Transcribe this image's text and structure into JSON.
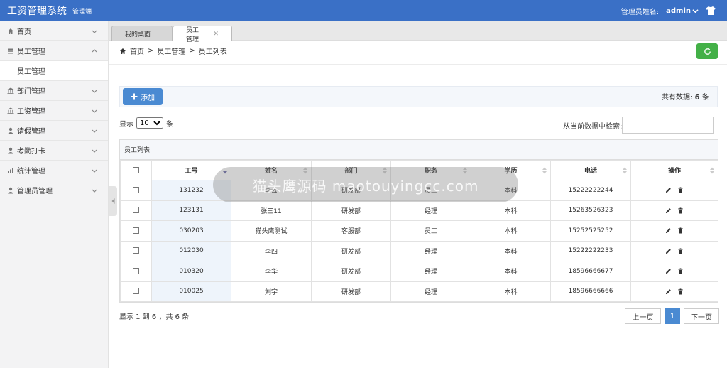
{
  "app": {
    "title": "工资管理系统",
    "subtitle": "管理端",
    "admin_label": "管理员姓名:",
    "admin_name": "admin"
  },
  "sidebar": {
    "items": [
      {
        "label": "首页",
        "icon": "home-icon"
      },
      {
        "label": "员工管理",
        "icon": "list-icon",
        "expanded": true,
        "sub": [
          "员工管理"
        ]
      },
      {
        "label": "部门管理",
        "icon": "bank-icon"
      },
      {
        "label": "工资管理",
        "icon": "bank-icon"
      },
      {
        "label": "请假管理",
        "icon": "user-icon"
      },
      {
        "label": "考勤打卡",
        "icon": "user-icon"
      },
      {
        "label": "统计管理",
        "icon": "chart-icon"
      },
      {
        "label": "管理员管理",
        "icon": "user-icon"
      }
    ]
  },
  "tabs": [
    {
      "label": "我的桌面"
    },
    {
      "label": "员工管理",
      "active": true
    }
  ],
  "breadcrumb": [
    "首页",
    "员工管理",
    "员工列表"
  ],
  "toolbar": {
    "add_label": "添加",
    "total_prefix": "共有数据:",
    "total_count": "6",
    "total_suffix": "条"
  },
  "length": {
    "prefix": "显示",
    "value": "10",
    "suffix": "条"
  },
  "search": {
    "label": "从当前数据中检索:",
    "value": ""
  },
  "table": {
    "title": "员工列表",
    "columns": [
      "工号",
      "姓名",
      "部门",
      "职务",
      "学历",
      "电话",
      "操作"
    ],
    "rows": [
      [
        "131232",
        "李云",
        "研发部",
        "员工",
        "本科",
        "15222222244"
      ],
      [
        "123131",
        "张三11",
        "研发部",
        "经理",
        "本科",
        "15263526323"
      ],
      [
        "030203",
        "猫头鹰测试",
        "客服部",
        "员工",
        "本科",
        "15252525252"
      ],
      [
        "012030",
        "李四",
        "研发部",
        "经理",
        "本科",
        "15222222233"
      ],
      [
        "010320",
        "李华",
        "研发部",
        "经理",
        "本科",
        "18596666677"
      ],
      [
        "010025",
        "刘宇",
        "研发部",
        "经理",
        "本科",
        "18596666666"
      ]
    ]
  },
  "footer": {
    "info": "显示 1 到 6 ，共 6 条",
    "prev": "上一页",
    "page": "1",
    "next": "下一页"
  },
  "watermark": {
    "text": "猫头鹰源码 maotouyingcc.com"
  },
  "colors": {
    "primary": "#3a70c6",
    "button": "#4a8ad2",
    "refresh": "#43b047"
  }
}
